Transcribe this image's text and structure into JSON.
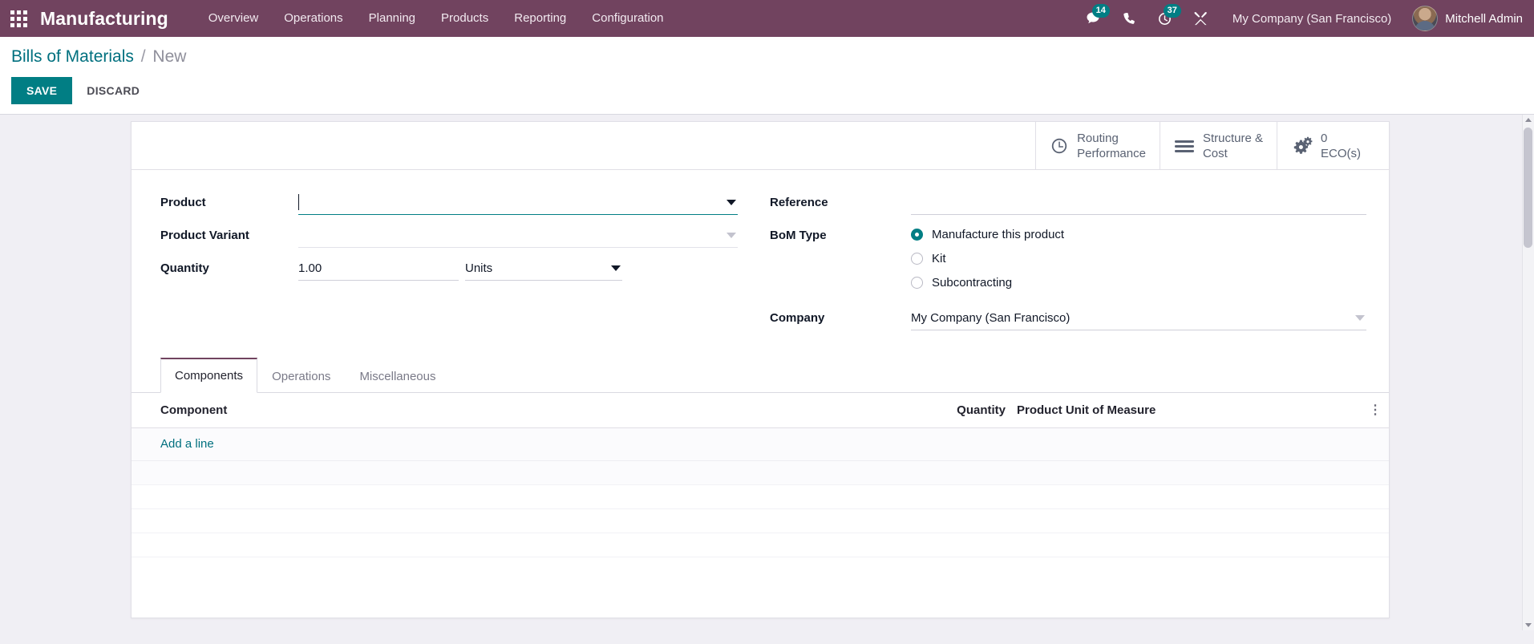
{
  "navbar": {
    "apps_icon": "apps-grid-icon",
    "brand": "Manufacturing",
    "menu": [
      {
        "label": "Overview"
      },
      {
        "label": "Operations"
      },
      {
        "label": "Planning"
      },
      {
        "label": "Products"
      },
      {
        "label": "Reporting"
      },
      {
        "label": "Configuration"
      }
    ],
    "messages_icon": "chat-bubble-icon",
    "messages_count": "14",
    "phone_icon": "phone-icon",
    "activity_icon": "clock-activity-icon",
    "activity_count": "37",
    "tools_icon": "wrench-tools-icon",
    "company": "My Company (San Francisco)",
    "avatar_icon": "user-avatar",
    "user": "Mitchell Admin",
    "accent_badge_color": "#017e84",
    "background_color": "#71435f"
  },
  "control_panel": {
    "breadcrumb_root": "Bills of Materials",
    "breadcrumb_separator": "/",
    "breadcrumb_current": "New",
    "save_label": "SAVE",
    "discard_label": "DISCARD",
    "save_color": "#017e84"
  },
  "stat_buttons": [
    {
      "icon": "clock-icon",
      "line1": "Routing",
      "line2": "Performance"
    },
    {
      "icon": "list-lines-icon",
      "line1": "Structure &",
      "line2": "Cost"
    },
    {
      "icon": "gears-icon",
      "line1": "0",
      "line2": "ECO(s)"
    }
  ],
  "form": {
    "left": {
      "product_label": "Product",
      "product_value": "",
      "product_placeholder": "",
      "product_variant_label": "Product Variant",
      "product_variant_value": "",
      "quantity_label": "Quantity",
      "quantity_value": "1.00",
      "uom_value": "Units"
    },
    "right": {
      "reference_label": "Reference",
      "reference_value": "",
      "bom_type_label": "BoM Type",
      "bom_type_options": [
        {
          "label": "Manufacture this product",
          "selected": true
        },
        {
          "label": "Kit",
          "selected": false
        },
        {
          "label": "Subcontracting",
          "selected": false
        }
      ],
      "company_label": "Company",
      "company_value": "My Company (San Francisco)"
    }
  },
  "notebook": {
    "tabs": [
      {
        "label": "Components",
        "active": true
      },
      {
        "label": "Operations",
        "active": false
      },
      {
        "label": "Miscellaneous",
        "active": false
      }
    ]
  },
  "components_table": {
    "columns": [
      "Component",
      "Quantity",
      "Product Unit of Measure"
    ],
    "rows": [],
    "add_line_label": "Add a line",
    "optional_columns_icon": "vertical-dots-icon"
  }
}
